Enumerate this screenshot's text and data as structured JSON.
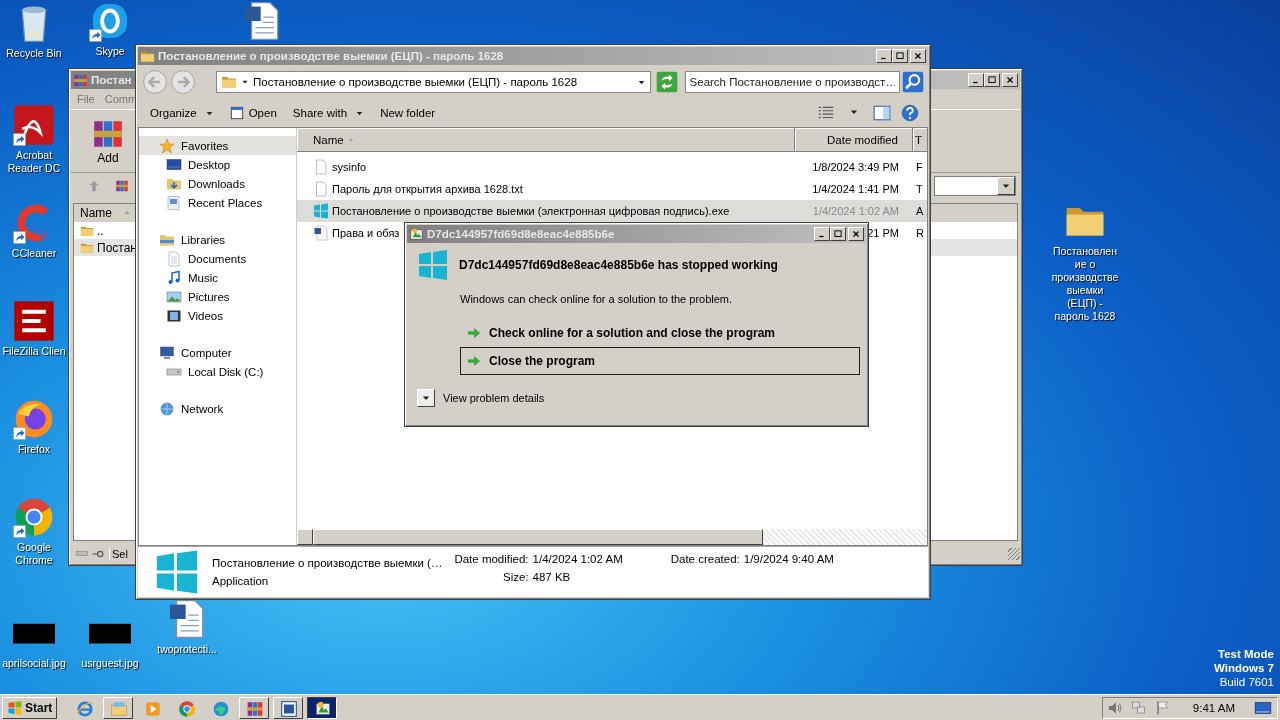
{
  "desktop_icons": [
    {
      "label": "Recycle Bin",
      "kind": "recycle",
      "shortcut": false
    },
    {
      "label": "Skype",
      "kind": "skype",
      "shortcut": true
    },
    {
      "kind": "word-doc",
      "shortcut": false
    },
    {
      "label": "Acrobat Reader DC",
      "kind": "acrobat",
      "shortcut": true
    },
    {
      "label": "CCleaner",
      "kind": "ccleaner",
      "shortcut": true
    },
    {
      "label": "FileZilla Clien",
      "kind": "filezilla",
      "shortcut": false
    },
    {
      "label": "Firefox",
      "kind": "firefox",
      "shortcut": true
    },
    {
      "label": "Google Chrome",
      "kind": "chrome",
      "shortcut": true
    },
    {
      "label": "aprilsocial.jpg",
      "kind": "image-file",
      "shortcut": false
    },
    {
      "label": "usrguest.jpg",
      "kind": "image-file",
      "shortcut": false
    },
    {
      "label": "twoprotecti...",
      "kind": "word-doc",
      "shortcut": false
    },
    {
      "label": "Постановление о производстве выемки (ЕЦП) - пароль 1628",
      "kind": "folder",
      "shortcut": false
    }
  ],
  "archiver_window": {
    "title": "Постан",
    "menu": [
      "File",
      "Comm"
    ],
    "toolbar_button": "Add",
    "column": "Name",
    "rows": [
      "..",
      "Постан"
    ],
    "status": "Sel"
  },
  "explorer": {
    "title": "Постановление о производстве выемки (ЕЦП) - пароль 1628",
    "address": "Постановление о производстве выемки (ЕЦП) - пароль 1628",
    "search_placeholder": "Search Постановление о производст…",
    "toolbar": [
      {
        "label": "Organize",
        "dropdown": true
      },
      {
        "label": "Open",
        "dropdown": false
      },
      {
        "label": "Share with",
        "dropdown": true
      },
      {
        "label": "New folder",
        "dropdown": false
      }
    ],
    "nav": [
      {
        "label": "Favorites",
        "kind": "star",
        "selected": true,
        "children": [
          {
            "label": "Desktop",
            "kind": "desktop",
            "selected": false
          },
          {
            "label": "Downloads",
            "kind": "downloads",
            "selected": false
          },
          {
            "label": "Recent Places",
            "kind": "recent",
            "selected": false
          }
        ]
      },
      {
        "label": "Libraries",
        "kind": "libraries",
        "selected": false,
        "children": [
          {
            "label": "Documents",
            "kind": "docs",
            "selected": false
          },
          {
            "label": "Music",
            "kind": "music",
            "selected": false
          },
          {
            "label": "Pictures",
            "kind": "pictures",
            "selected": false
          },
          {
            "label": "Videos",
            "kind": "videos",
            "selected": false
          }
        ]
      },
      {
        "label": "Computer",
        "kind": "computer",
        "selected": false,
        "children": [
          {
            "label": "Local Disk (C:)",
            "kind": "disk",
            "selected": false
          }
        ]
      },
      {
        "label": "Network",
        "kind": "network",
        "selected": false
      }
    ],
    "columns": [
      {
        "label": "Name",
        "sorted": true
      },
      {
        "label": "Date modified",
        "sorted": false
      },
      {
        "label": "T",
        "sorted": false
      }
    ],
    "files": [
      {
        "name": "sysinfo",
        "date_modified": "1/8/2024 3:49 PM",
        "column_3": "F",
        "kind": "txt",
        "selected": false
      },
      {
        "name": "Пароль для открытия архива 1628.txt",
        "date_modified": "1/4/2024 1:41 PM",
        "column_3": "T",
        "kind": "txt",
        "selected": false
      },
      {
        "name": "Постановление о производстве выемки (электронная цифровая подпись).exe",
        "date_modified": "1/4/2024 1:02 AM",
        "column_3": "A",
        "kind": "winlogo",
        "selected": true
      },
      {
        "name": "Права и обяз",
        "date_modified": "21 PM",
        "column_3": "R",
        "kind": "wordfile",
        "selected": false
      }
    ],
    "details": {
      "name": "Постановление о производстве выемки (…",
      "type": "Application",
      "fields": [
        {
          "label": "Date modified:",
          "value": "1/4/2024 1:02 AM"
        },
        {
          "label": "Size:",
          "value": "487 KB"
        },
        {
          "label": "Date created:",
          "value": "1/9/2024 9:40 AM"
        }
      ]
    }
  },
  "dialog": {
    "title": "D7dc144957fd69d8e8eac4e885b6e",
    "heading": "D7dc144957fd69d8e8eac4e885b6e has stopped working",
    "message": "Windows can check online for a solution to the problem.",
    "options": [
      {
        "label": "Check online for a solution and close the program",
        "focused": false
      },
      {
        "label": "Close the program",
        "focused": true
      }
    ],
    "details_toggle": "View problem details"
  },
  "system_notice": [
    "Test Mode",
    "Windows 7",
    "Build 7601"
  ],
  "taskbar": {
    "start": "Start",
    "apps": [
      {
        "kind": "ie",
        "open": false,
        "selected": false
      },
      {
        "kind": "explorer",
        "open": true,
        "selected": false
      },
      {
        "kind": "media",
        "open": false,
        "selected": false
      },
      {
        "kind": "chrome",
        "open": false,
        "selected": false
      },
      {
        "kind": "edge",
        "open": false,
        "selected": false
      },
      {
        "kind": "winrar",
        "open": true,
        "selected": false
      },
      {
        "kind": "wordapp",
        "open": true,
        "selected": false
      },
      {
        "kind": "app",
        "open": true,
        "selected": true
      }
    ],
    "clock": "9:41 AM"
  }
}
